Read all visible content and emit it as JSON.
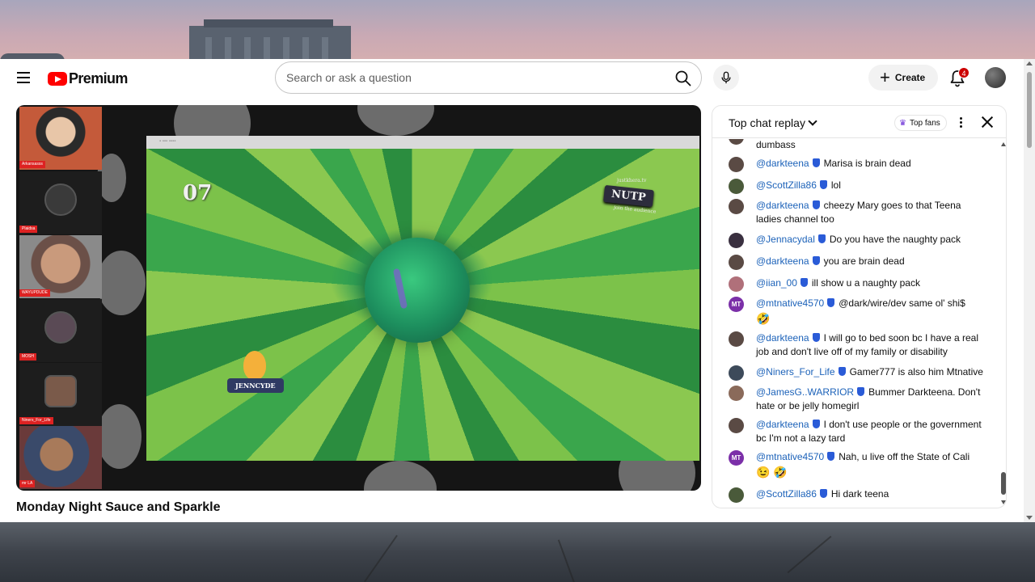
{
  "header": {
    "brand": "Premium",
    "search_placeholder": "Search or ask a question",
    "create_label": "Create",
    "notification_count": "4"
  },
  "video": {
    "title": "Monday Night Sauce and Sparkle",
    "game": {
      "score": "07",
      "badge": "NUTP",
      "badge_top": "justkhera.tv",
      "badge_bottom": "join the audience",
      "player_name": "JENNCYDE"
    },
    "participants": [
      "Arkansasss",
      "Plaidsa",
      "WAYUPDUDE",
      "MOSH",
      "Niners_For_Life",
      "mr LA"
    ]
  },
  "chat": {
    "mode": "Top chat replay",
    "top_fans": "Top fans",
    "partial_message": "dumbass",
    "messages": [
      {
        "author": "@darkteena",
        "text": "Marisa is brain dead",
        "avatar_color": "#5a4a44"
      },
      {
        "author": "@ScottZilla86",
        "text": "lol",
        "avatar_color": "#4a5a3a"
      },
      {
        "author": "@darkteena",
        "text": "cheezy Mary goes to that Teena ladies channel too",
        "avatar_color": "#5a4a44"
      },
      {
        "author": "@Jennacydal",
        "text": "Do you have the naughty pack",
        "avatar_color": "#3a3040"
      },
      {
        "author": "@darkteena",
        "text": "you are brain dead",
        "avatar_color": "#5a4a44"
      },
      {
        "author": "@iian_00",
        "text": "ill show u a naughty pack",
        "avatar_color": "#b0707a"
      },
      {
        "author": "@mtnative4570",
        "text": "@dark/wire/dev same ol' shi$",
        "emoji": "🤣",
        "avatar_initials": "MT",
        "avatar_color": "#7b2fa8"
      },
      {
        "author": "@darkteena",
        "text": "I will go to bed soon bc I have a real job and don't live off of my family or disability",
        "avatar_color": "#5a4a44"
      },
      {
        "author": "@Niners_For_Life",
        "text": "Gamer777 is also him Mtnative",
        "avatar_color": "#3d4a5a"
      },
      {
        "author": "@JamesG..WARRIOR",
        "text": "Bummer Darkteena. Don't hate or be jelly homegirl",
        "avatar_color": "#8a6a5a"
      },
      {
        "author": "@darkteena",
        "text": "I don't use people or the government bc I'm not a lazy tard",
        "avatar_color": "#5a4a44"
      },
      {
        "author": "@mtnative4570",
        "text": "Nah, u live off the State of Cali",
        "emoji": "😉 🤣",
        "avatar_initials": "MT",
        "avatar_color": "#7b2fa8"
      },
      {
        "author": "@ScottZilla86",
        "text": "Hi dark teena",
        "avatar_color": "#4a5a3a"
      }
    ]
  }
}
